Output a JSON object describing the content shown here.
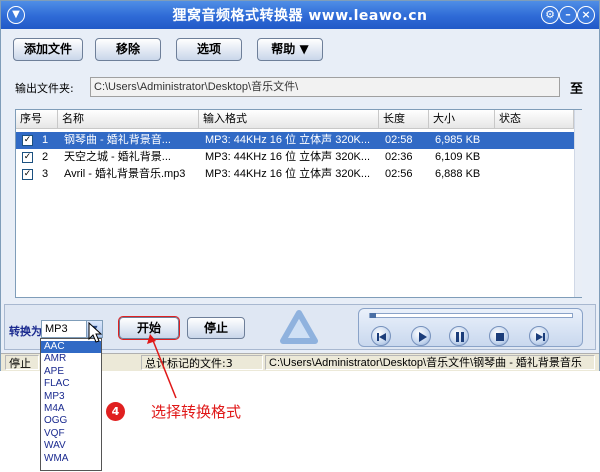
{
  "title": "狸窝音频格式转换器 www.leawo.cn",
  "toolbar": {
    "add_files": "添加文件",
    "remove": "移除",
    "options": "选项",
    "help": "帮助 ▼"
  },
  "output": {
    "label": "输出文件夹:",
    "path": "C:\\Users\\Administrator\\Desktop\\音乐文件\\",
    "browse": "至"
  },
  "table": {
    "columns": [
      "序号",
      "名称",
      "输入格式",
      "长度",
      "大小",
      "状态"
    ],
    "rows": [
      {
        "index": "1",
        "name": "钢琴曲 - 婚礼背景音...",
        "format": "MP3: 44KHz 16 位 立体声 320K...",
        "length": "02:58",
        "size": "6,985 KB",
        "status": ""
      },
      {
        "index": "2",
        "name": "天空之城 - 婚礼背景...",
        "format": "MP3: 44KHz 16 位 立体声 320K...",
        "length": "02:36",
        "size": "6,109 KB",
        "status": ""
      },
      {
        "index": "3",
        "name": "Avril - 婚礼背景音乐.mp3",
        "format": "MP3: 44KHz 16 位 立体声 320K...",
        "length": "02:56",
        "size": "6,888 KB",
        "status": ""
      }
    ]
  },
  "convert": {
    "label": "转换为",
    "selected": "MP3",
    "options": [
      "AAC",
      "AMR",
      "APE",
      "FLAC",
      "MP3",
      "M4A",
      "OGG",
      "VQF",
      "WAV",
      "WMA"
    ],
    "highlighted": "AAC",
    "start": "开始",
    "stop": "停止"
  },
  "status": {
    "state": "停止",
    "total": "总计标记的文件:3",
    "current_path": "C:\\Users\\Administrator\\Desktop\\音乐文件\\钢琴曲 - 婚礼背景音乐"
  },
  "annotation": {
    "step": "4",
    "text": "选择转换格式",
    "color": "#e01818"
  },
  "colors": {
    "titlebar": "#2e6ad6",
    "selection": "#316ac5"
  }
}
